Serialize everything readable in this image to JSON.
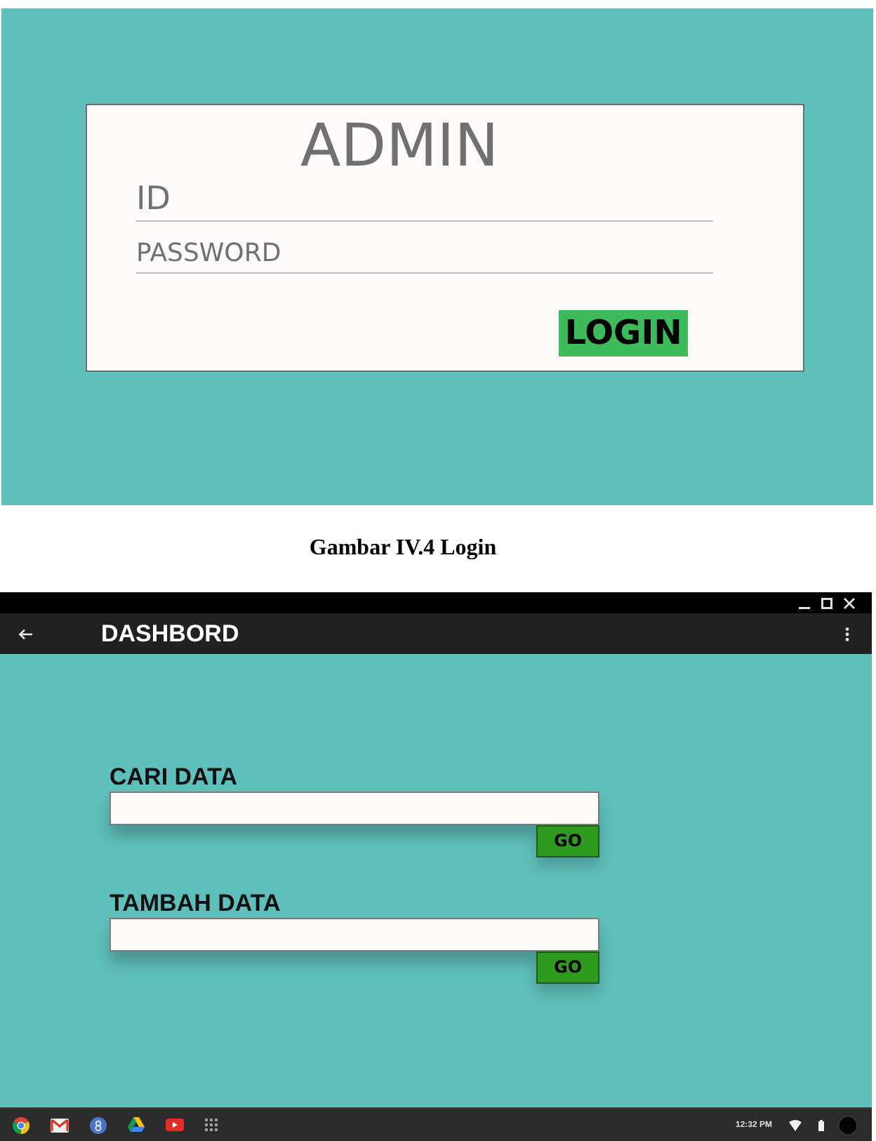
{
  "login_screen": {
    "title": "ADMIN",
    "fields": [
      {
        "kind": "text",
        "placeholder": "ID"
      },
      {
        "kind": "password",
        "placeholder": "PASSWORD"
      }
    ],
    "button": "LOGIN"
  },
  "caption": "Gambar IV.4 Login",
  "dashboard": {
    "app_bar": {
      "title": "DASHBORD"
    },
    "sections": [
      {
        "label": "CARI DATA",
        "button": "GO"
      },
      {
        "label": "TAMBAH DATA",
        "button": "GO"
      }
    ],
    "taskbar": {
      "clock": "12:32 PM"
    }
  }
}
